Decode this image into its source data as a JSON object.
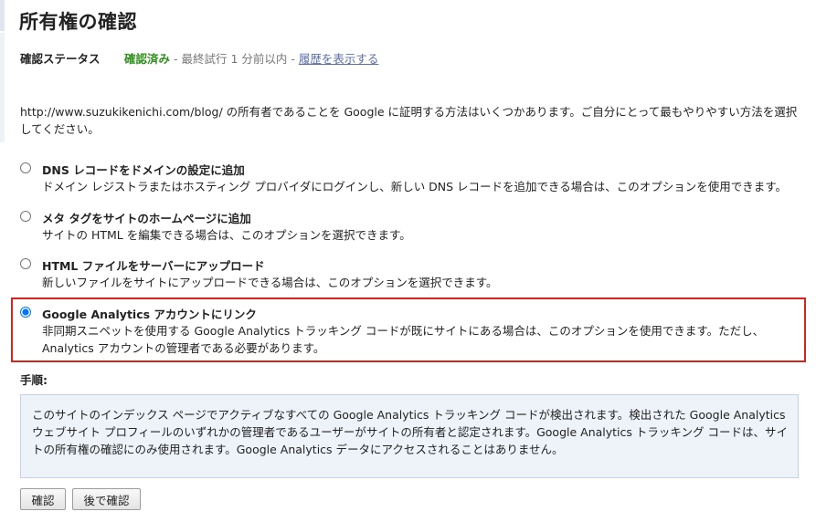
{
  "page": {
    "title": "所有権の確認"
  },
  "status": {
    "label": "確認ステータス",
    "value": "確認済み",
    "separator1": " - ",
    "last_attempt": "最終試行 1 分前以内",
    "separator2": " - ",
    "history_link": "履歴を表示する"
  },
  "intro": "http://www.suzukikenichi.com/blog/ の所有者であることを Google に証明する方法はいくつかあります。ご自分にとって最もやりやすい方法を選択してください。",
  "options": [
    {
      "title": "DNS レコードをドメインの設定に追加",
      "description": "ドメイン レジストラまたはホスティング プロバイダにログインし、新しい DNS レコードを追加できる場合は、このオプションを使用できます。",
      "selected": false
    },
    {
      "title": "メタ タグをサイトのホームページに追加",
      "description": "サイトの HTML を編集できる場合は、このオプションを選択できます。",
      "selected": false
    },
    {
      "title": "HTML ファイルをサーバーにアップロード",
      "description": "新しいファイルをサイトにアップロードできる場合は、このオプションを選択できます。",
      "selected": false
    },
    {
      "title": "Google Analytics アカウントにリンク",
      "description": "非同期スニペットを使用する Google Analytics トラッキング コードが既にサイトにある場合は、このオプションを使用できます。ただし、Analytics アカウントの管理者である必要があります。",
      "selected": true
    }
  ],
  "steps": {
    "label": "手順:",
    "text": "このサイトのインデックス ページでアクティブなすべての Google Analytics トラッキング コードが検出されます。検出された Google Analytics ウェブサイト プロフィールのいずれかの管理者であるユーザーがサイトの所有者と認定されます。Google Analytics トラッキング コードは、サイトの所有権の確認にのみ使用されます。Google Analytics データにアクセスされることはありません。"
  },
  "buttons": {
    "verify": "確認",
    "later": "後で確認"
  },
  "colors": {
    "status_green": "#2f8e1c",
    "link_blue": "#5a6eaa",
    "highlight_red": "#d9231f",
    "info_bg": "#eef3fa"
  }
}
